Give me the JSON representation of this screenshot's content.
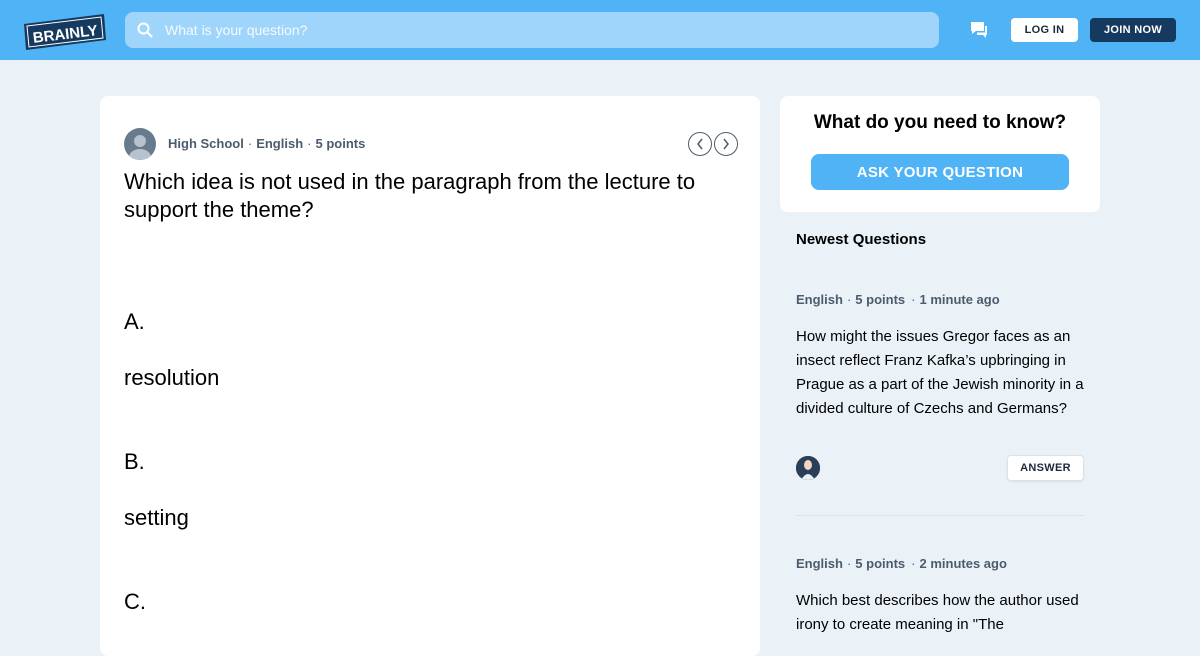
{
  "header": {
    "logo_text": "BRAINLY",
    "search_placeholder": "What is your question?",
    "login_label": "LOG IN",
    "join_label": "JOIN NOW",
    "colors": {
      "bar": "#4fb3f6",
      "join_bg": "#163a5f"
    }
  },
  "question": {
    "level": "High School",
    "subject": "English",
    "points": "5 points",
    "separator": "·",
    "text": "Which idea is not used in the paragraph from the lecture to support the theme?",
    "options": [
      {
        "letter": "A.",
        "text": "resolution"
      },
      {
        "letter": "B.",
        "text": "setting"
      },
      {
        "letter": "C.",
        "text": ""
      }
    ],
    "prev_icon": "chevron-left-icon",
    "next_icon": "chevron-right-icon"
  },
  "sidebar": {
    "ask_title": "What do you need to know?",
    "ask_button": "ASK YOUR QUESTION",
    "newest_title": "Newest Questions",
    "items": [
      {
        "subject": "English",
        "points": "5 points",
        "time": "1 minute ago",
        "text": "How might the issues Gregor faces as an insect reflect Franz Kafka’s upbringing in Prague as a part of the Jewish minority in a divided culture of Czechs and Germans?",
        "answer_label": "ANSWER"
      },
      {
        "subject": "English",
        "points": "5 points",
        "time": "2 minutes ago",
        "text": "Which best describes how the author used irony to create meaning in \"The"
      }
    ]
  }
}
